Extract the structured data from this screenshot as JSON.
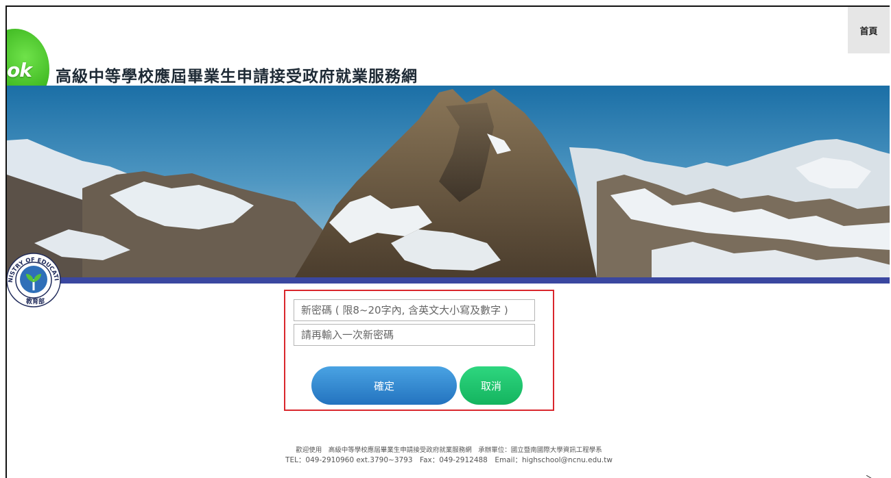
{
  "header": {
    "site_title": "高級中等學校應屆畢業生申請接受政府就業服務網",
    "logo_text": "ok",
    "home_button": "首頁"
  },
  "badge": {
    "text": "MINISTRY OF EDUCATION",
    "chinese": "教育部"
  },
  "form": {
    "new_password_placeholder": "新密碼 ( 限8~20字內, 含英文大小寫及數字 )",
    "confirm_password_placeholder": "請再輸入一次新密碼",
    "new_password_value": "",
    "confirm_password_value": "",
    "confirm_button": "確定",
    "cancel_button": "取消"
  },
  "footer": {
    "line1": "歡迎使用　高級中等學校應屆畢業生申請接受政府就業服務網　承辦單位：國立暨南國際大學資訊工程學系",
    "line2": "TEL：049-2910960 ext.3790~3793　Fax：049-2912488　Email：highschool@ncnu.edu.tw"
  },
  "colors": {
    "accent_blue": "#2a7bc8",
    "accent_green": "#1cc46a",
    "form_border": "#d9262c",
    "banner_stripe": "#3a47a0"
  }
}
